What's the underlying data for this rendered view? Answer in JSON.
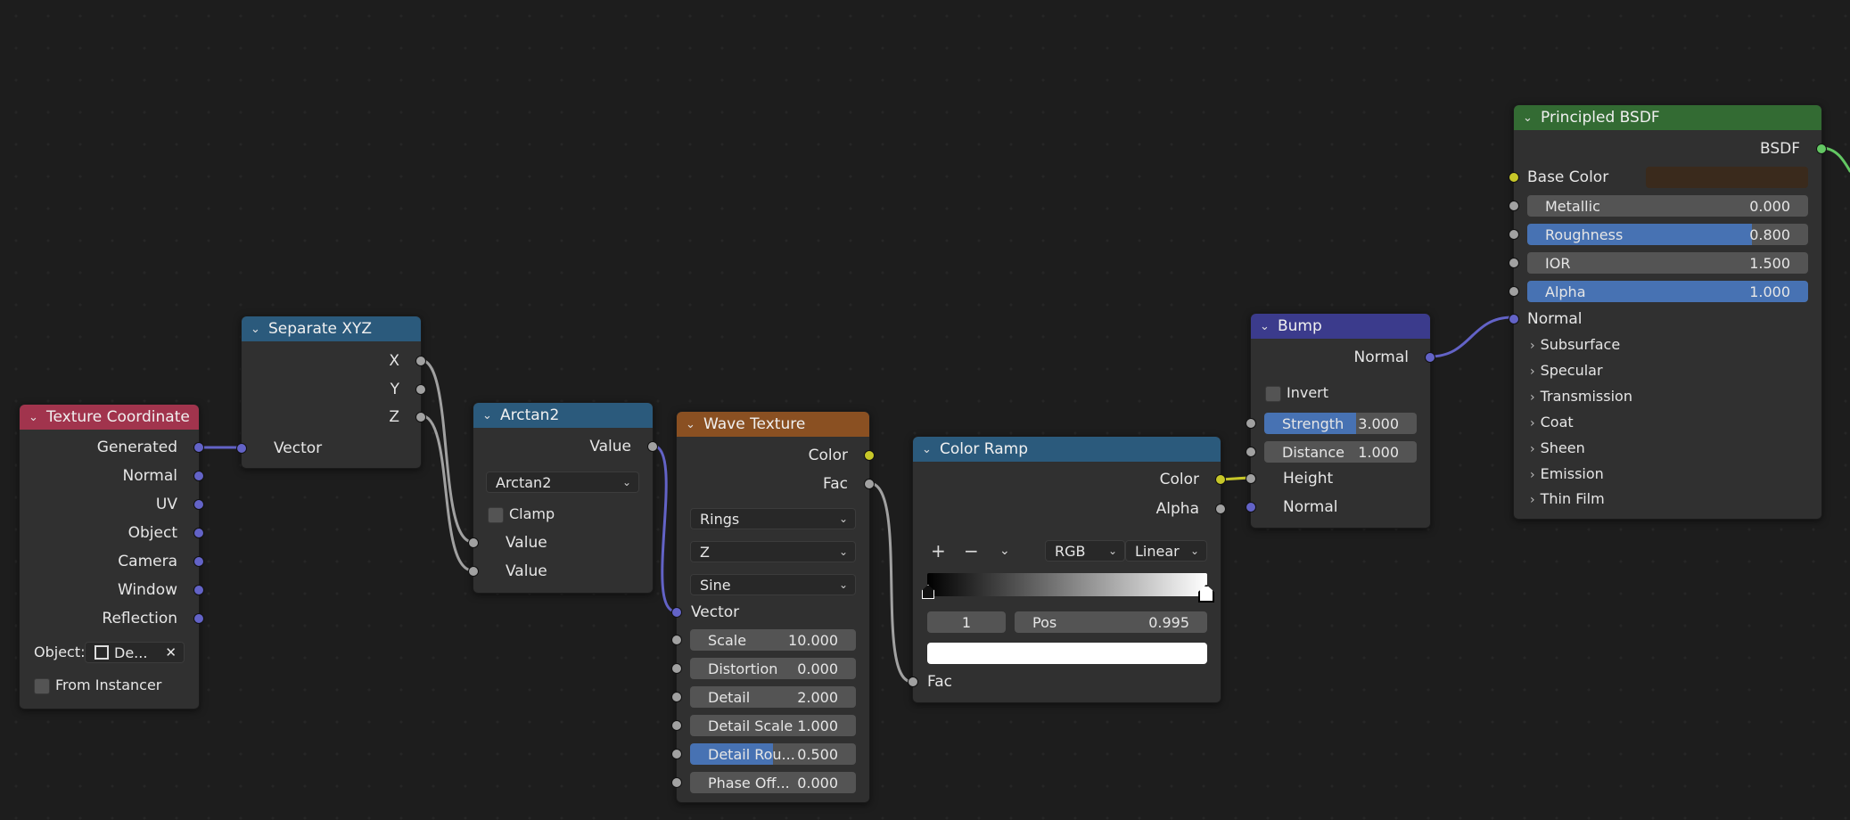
{
  "nodes": {
    "texture_coordinate": {
      "title": "Texture Coordinate",
      "header_color": "#a1344d",
      "outputs": [
        "Generated",
        "Normal",
        "UV",
        "Object",
        "Camera",
        "Window",
        "Reflection"
      ],
      "object_label": "Object:",
      "object_value": "De...",
      "from_instancer": "From Instancer"
    },
    "separate_xyz": {
      "title": "Separate XYZ",
      "header_color": "#2b5a7c",
      "outputs": [
        "X",
        "Y",
        "Z"
      ],
      "input": "Vector"
    },
    "arctan2": {
      "title": "Arctan2",
      "header_color": "#2b5a7c",
      "output": "Value",
      "operation": "Arctan2",
      "clamp": "Clamp",
      "inputs": [
        "Value",
        "Value"
      ]
    },
    "wave_texture": {
      "title": "Wave Texture",
      "header_color": "#8a5022",
      "outputs": [
        "Color",
        "Fac"
      ],
      "wave_type": "Rings",
      "direction": "Z",
      "profile": "Sine",
      "vector_input": "Vector",
      "fields": [
        {
          "label": "Scale",
          "value": "10.000",
          "fill": 0
        },
        {
          "label": "Distortion",
          "value": "0.000",
          "fill": 0
        },
        {
          "label": "Detail",
          "value": "2.000",
          "fill": 0
        },
        {
          "label": "Detail Scale",
          "value": "1.000",
          "fill": 0
        },
        {
          "label": "Detail Rou...",
          "value": "0.500",
          "fill": 0.5
        },
        {
          "label": "Phase Off...",
          "value": "0.000",
          "fill": 0
        }
      ]
    },
    "color_ramp": {
      "title": "Color Ramp",
      "header_color": "#2b5a7c",
      "outputs": [
        "Color",
        "Alpha"
      ],
      "color_mode": "RGB",
      "interpolation": "Linear",
      "stop_index": "1",
      "pos_label": "Pos",
      "pos_value": "0.995",
      "input": "Fac"
    },
    "bump": {
      "title": "Bump",
      "header_color": "#3b3b8c",
      "output": "Normal",
      "invert": "Invert",
      "strength_label": "Strength",
      "strength_value": "3.000",
      "strength_fill": 0.6,
      "distance_label": "Distance",
      "distance_value": "1.000",
      "inputs": [
        "Height",
        "Normal"
      ]
    },
    "principled_bsdf": {
      "title": "Principled BSDF",
      "header_color": "#336b33",
      "output": "BSDF",
      "base_color_label": "Base Color",
      "base_color_swatch": "#3a2a1c",
      "fields": [
        {
          "label": "Metallic",
          "value": "0.000",
          "fill": 0
        },
        {
          "label": "Roughness",
          "value": "0.800",
          "fill": 0.8
        },
        {
          "label": "IOR",
          "value": "1.500",
          "fill": 0
        },
        {
          "label": "Alpha",
          "value": "1.000",
          "fill": 1
        }
      ],
      "normal_input": "Normal",
      "panels": [
        "Subsurface",
        "Specular",
        "Transmission",
        "Coat",
        "Sheen",
        "Emission",
        "Thin Film"
      ]
    }
  }
}
